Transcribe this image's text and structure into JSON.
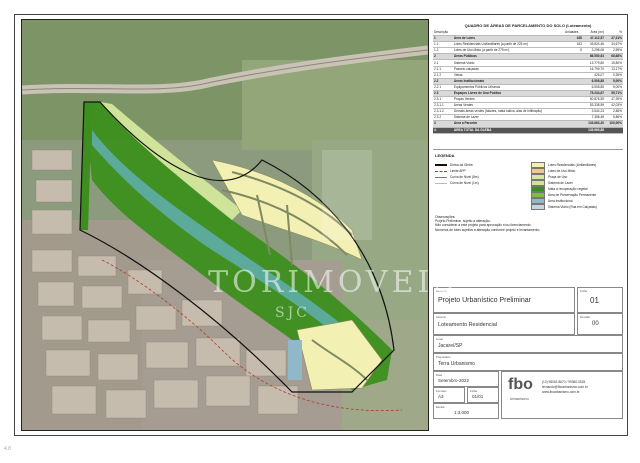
{
  "table": {
    "title": "QUADRO DE ÁREAS DE PARCELAMENTO DO SOLO (Loteamento)",
    "header": [
      "Descrição",
      "Unidades",
      "Área (m²)",
      "%"
    ],
    "rows": [
      {
        "id": "1",
        "desc": "Área de Lotes",
        "units": "168",
        "area": "47.112,57",
        "pct": "37,31%",
        "style": "hl"
      },
      {
        "id": "1.1",
        "desc": "Lotes Residenciais Unifamiliares (a partir de 225 m²)",
        "units": "163",
        "area": "43.824,46",
        "pct": "34,67%",
        "style": ""
      },
      {
        "id": "1.2",
        "desc": "Lotes de Uso Misto (a partir de 275 m²)",
        "units": "5",
        "area": "3.298,06",
        "pct": "2,59%",
        "style": ""
      },
      {
        "id": "2",
        "desc": "Áreas Públicas",
        "units": "",
        "area": "86.550,63",
        "pct": "68,68%",
        "style": "hl"
      },
      {
        "id": "2.1",
        "desc": "Sistema Viário",
        "units": "",
        "area": "13.779,80",
        "pct": "15,80%",
        "style": ""
      },
      {
        "id": "2.1.1",
        "desc": "Passeio calçadas",
        "units": "",
        "area": "16.799,70",
        "pct": "13,17%",
        "style": ""
      },
      {
        "id": "2.1.2",
        "desc": "Vielas",
        "units": "",
        "area": "425,07",
        "pct": "0,35%",
        "style": ""
      },
      {
        "id": "2.2",
        "desc": "Áreas Institucionais",
        "units": "",
        "area": "6.508,85",
        "pct": "5,00%",
        "style": "hl"
      },
      {
        "id": "2.2.1",
        "desc": "Equipamentos Públicos Urbanos",
        "units": "",
        "area": "6.508,85",
        "pct": "5,00%",
        "style": ""
      },
      {
        "id": "2.3",
        "desc": "Espaços Livres de Uso Público",
        "units": "",
        "area": "75.234,67",
        "pct": "55,71%",
        "style": "hl"
      },
      {
        "id": "2.3.1",
        "desc": "Praças Verdes",
        "units": "",
        "area": "50.876,59",
        "pct": "47,39%",
        "style": ""
      },
      {
        "id": "2.3.1.1",
        "desc": "Áreas Verdes",
        "units": "",
        "area": "53.338,59",
        "pct": "42,03%",
        "style": ""
      },
      {
        "id": "2.3.1.2",
        "desc": "Demais áreas verdes (taludes, mata nativa, alas de infiltração)",
        "units": "",
        "area": "3.544,24",
        "pct": "2,86%",
        "style": ""
      },
      {
        "id": "2.3.2",
        "desc": "Sistema de Lazer",
        "units": "",
        "area": "7.358,48",
        "pct": "5,86%",
        "style": ""
      },
      {
        "id": "3",
        "desc": "Área a Parcelar",
        "units": "",
        "area": "133.663,20",
        "pct": "100,00%",
        "style": "hl"
      },
      {
        "id": "4",
        "desc": "ÁREA TOTAL DA GLEBA",
        "units": "",
        "area": "135.969,88",
        "pct": "",
        "style": "dark"
      }
    ]
  },
  "legend": {
    "title": "LEGENDA",
    "line_items": [
      {
        "label": "Divisa da Gleba",
        "style": "solid"
      },
      {
        "label": "Limite APP",
        "style": "dashed"
      },
      {
        "label": "Curva de Nível (5m)",
        "style": "thin"
      },
      {
        "label": "Curva de Nível (1m)",
        "style": "faint"
      }
    ],
    "fill_items": [
      {
        "label": "Lotes Residenciais (Unifamiliares)",
        "color": "#f3f0b3"
      },
      {
        "label": "Lotes de Uso Misto",
        "color": "#efc88c"
      },
      {
        "label": "Praça de Uso",
        "color": "#d7e7a5"
      },
      {
        "label": "Sistema de Lazer",
        "color": "#cfe39a"
      },
      {
        "label": "Mata a recuperação vegetal",
        "color": "#3c8f1e"
      },
      {
        "label": "Área de Preservação Permanente",
        "color": "#7bbf3d"
      },
      {
        "label": "Área Institucional",
        "color": "#8fb9c9"
      },
      {
        "label": "Sistema Viário (Rua em Calçadas)",
        "color": "#c9d4e0"
      }
    ],
    "notes_title": "Observações:",
    "notes": [
      "Projeto Preliminar, sujeito a alteração.",
      "Não considerar a este projeto para aprovação e/ou licenciamento.",
      "Números de lotes sujeitos a alteração conforme projeto e levantamento."
    ]
  },
  "title_block": {
    "drawing_label": "Desenho",
    "drawing": "Projeto Urbanístico Preliminar",
    "sheet_label": "Folha",
    "sheet": "01",
    "subject_label": "Assunto",
    "subject": "Loteamento Residencial",
    "rev_label": "Revisão",
    "rev": "00",
    "location_label": "Local",
    "location": "Jacareí/SP",
    "client_label": "Proprietário",
    "client": "Terra Urbanismo",
    "date_label": "Data",
    "date": "Setembro-2022",
    "format_label": "Formato",
    "format": "A3",
    "page_label": "Folha",
    "page": "01/01",
    "scale_label": "Escala",
    "scale": "1:3.000",
    "logo_text": "fbo",
    "logo_sub": "urbanismo",
    "phone": "(12) 98052-8670 / 99380-0525",
    "email": "fernando@fboarbanismo.com.br",
    "site": "www.fboarbanismo.com.br"
  },
  "watermark": {
    "text": "TORIMOVEIS",
    "sub": "SJC"
  },
  "footer": "4.8"
}
